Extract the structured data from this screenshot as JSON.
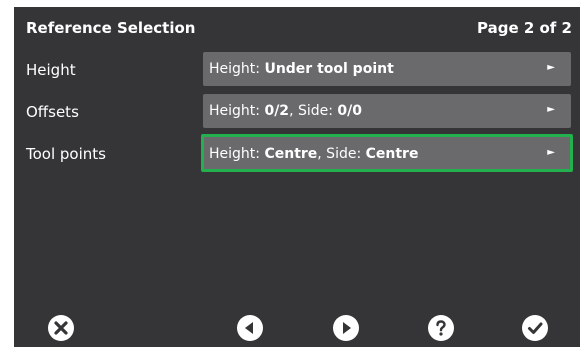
{
  "header": {
    "title": "Reference Selection",
    "page": "Page 2 of 2"
  },
  "rows": [
    {
      "label": "Height",
      "parts": [
        {
          "text": "Height: ",
          "bold": false
        },
        {
          "text": "Under tool point",
          "bold": true
        }
      ]
    },
    {
      "label": "Offsets",
      "parts": [
        {
          "text": "Height: ",
          "bold": false
        },
        {
          "text": "0/2",
          "bold": true
        },
        {
          "text": ", Side: ",
          "bold": false
        },
        {
          "text": "0/0",
          "bold": true
        }
      ]
    },
    {
      "label": "Tool points",
      "parts": [
        {
          "text": "Height: ",
          "bold": false
        },
        {
          "text": "Centre",
          "bold": true
        },
        {
          "text": ", Side: ",
          "bold": false
        },
        {
          "text": "Centre",
          "bold": true
        }
      ]
    }
  ],
  "arrow_glyph": "►",
  "footer": {
    "buttons": [
      "close-icon",
      "previous-icon",
      "next-icon",
      "help-icon",
      "confirm-icon"
    ]
  },
  "colors": {
    "background": "#353537",
    "field": "#6a6a6d",
    "selected_border": "#22b14c",
    "text": "#ffffff"
  }
}
